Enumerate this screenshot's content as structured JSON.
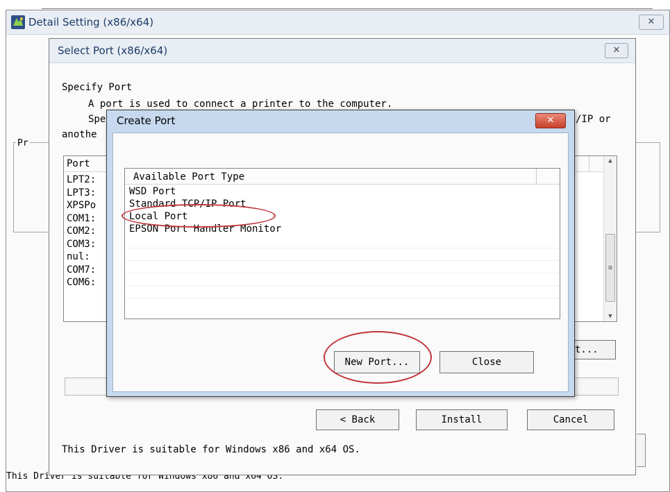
{
  "outer_window": {
    "title": "Detail Setting (x86/x64)",
    "close_icon": "close-icon",
    "group_label": "Pr",
    "footer": "This Driver is suitable for Windows x86 and x64 OS."
  },
  "select_port": {
    "title": "Select Port (x86/x64)",
    "close_icon": "close-icon",
    "specify": "Specify Port",
    "line1": "A port is used to connect a printer to the computer.",
    "line2_start": "Spe",
    "line2_end": "/IP or",
    "line3": "anothe",
    "list_header": "Port",
    "ports": [
      "LPT2:",
      "LPT3:",
      "XPSPo",
      "COM1:",
      "COM2:",
      "COM3:",
      "nul:",
      "COM7:",
      "COM6:"
    ],
    "partial_button": "t...",
    "back": "< Back",
    "install": "Install",
    "cancel": "Cancel",
    "footer": "This Driver is suitable for Windows x86 and x64 OS."
  },
  "create_port": {
    "title": "Create Port",
    "column_header": "Available Port Type",
    "port_types": [
      "WSD Port",
      "Standard TCP/IP Port",
      "Local Port",
      "EPSON Port Handler Monitor"
    ],
    "new_port": "New Port...",
    "close": "Close"
  },
  "colors": {
    "annotation": "#c0353a",
    "create_port_frame": "#c6d9ee",
    "close_button": "#c9402b"
  }
}
